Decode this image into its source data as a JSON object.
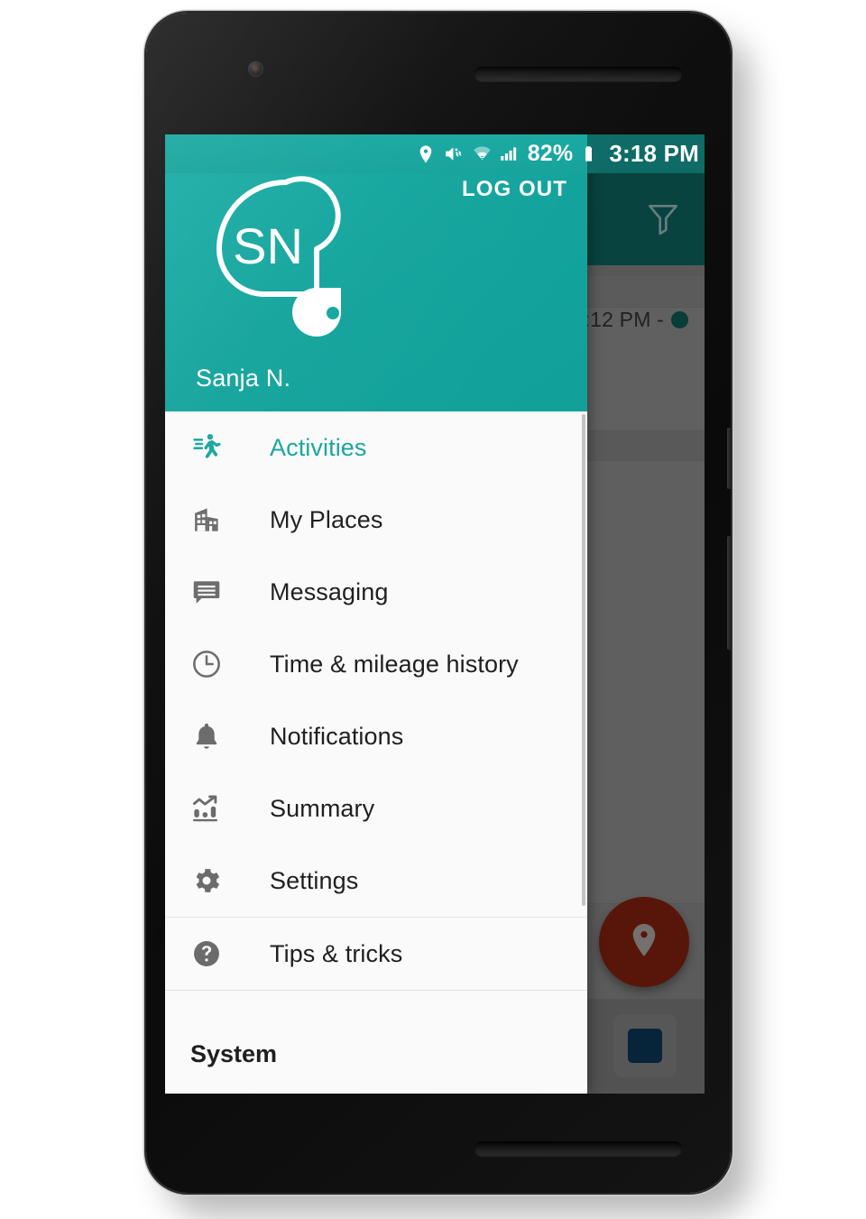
{
  "status_bar": {
    "icons": [
      "location-pin-icon",
      "volume-off-vibrate-icon",
      "wifi-icon",
      "signal-icon"
    ],
    "battery_percent": "82%",
    "battery_icon": "battery-icon",
    "clock": "3:18 PM"
  },
  "drawer": {
    "logout_label": "LOG OUT",
    "avatar_initials": "SN",
    "avatar_icon": "pin-avatar-icon",
    "user_name": "Sanja N.",
    "groups": [
      {
        "items": [
          {
            "label": "Activities",
            "icon": "walking-person-icon",
            "active": true
          },
          {
            "label": "My Places",
            "icon": "building-icon",
            "active": false
          },
          {
            "label": "Messaging",
            "icon": "chat-bubble-icon",
            "active": false
          },
          {
            "label": "Time & mileage history",
            "icon": "clock-icon",
            "active": false
          },
          {
            "label": "Notifications",
            "icon": "bell-icon",
            "active": false
          },
          {
            "label": "Summary",
            "icon": "bar-chart-trend-icon",
            "active": false
          },
          {
            "label": "Settings",
            "icon": "gear-icon",
            "active": false
          }
        ]
      },
      {
        "items": [
          {
            "label": "Tips & tricks",
            "icon": "help-circle-icon",
            "active": false
          }
        ]
      }
    ],
    "system_label": "System"
  },
  "background_app": {
    "filter_icon": "filter-funnel-icon",
    "row_time_text": ":12 PM -",
    "fab_icon": "map-pin-icon",
    "stop_button_icon": "stop-square-icon"
  },
  "colors": {
    "accent_teal": "#16a69f",
    "appbar_dark_teal": "#0d6b66",
    "status_bar_dark": "#0e6b66",
    "icon_gray": "#6b6b6b",
    "text_dark": "#1f1f1f",
    "fab_red": "#8c2410",
    "stop_blue": "#0b3a5c"
  }
}
